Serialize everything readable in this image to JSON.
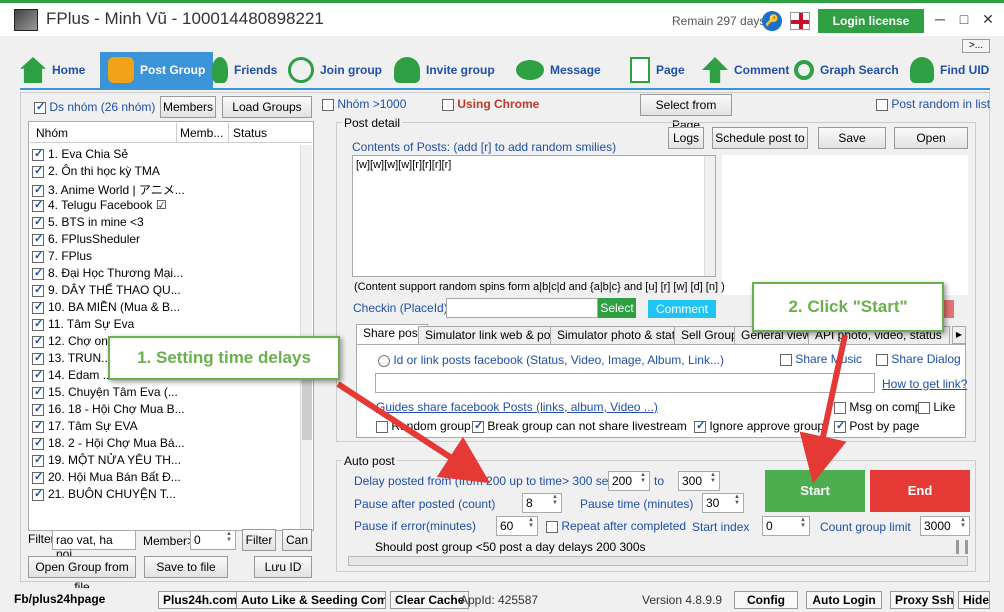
{
  "window": {
    "title": "FPlus - Minh Vũ - 100014480898221",
    "remain": "Remain 297 days",
    "login_license": "Login license",
    "minimize": "─",
    "maximize": "□",
    "close": "✕",
    "more": ">..."
  },
  "toolbar": {
    "home": "Home",
    "post_group": "Post Group",
    "friends": "Friends",
    "join_group": "Join group",
    "invite_group": "Invite group",
    "message": "Message",
    "page": "Page",
    "comment": "Comment",
    "graph_search": "Graph Search",
    "find_uid": "Find UID"
  },
  "left": {
    "ds_nhom": "Ds nhóm (26 nhóm)",
    "members_btn": "Members",
    "load_groups_btn": "Load Groups",
    "columns": [
      "Nhóm",
      "Memb...",
      "Status"
    ],
    "groups": [
      "1. Eva Chia Sẻ",
      "2. Ôn thi học kỳ TMA",
      "3. Anime World | アニメ...",
      "4. Telugu Facebook ☑",
      "5. BTS in mine <3",
      "6. FPlusSheduler",
      "7. FPlus",
      "8. Đại Học Thương Mại...",
      "9. DÂY THỂ THAO QU...",
      "10. BA MIỀN (Mua & B...",
      "11. Tâm Sự Eva",
      "12. Chợ on...",
      "13. TRUN...",
      "14. Edam ...",
      "15. Chuyện Tâm Eva (...",
      "16. 18 - Hội Chợ Mua B...",
      "17. Tâm Sự EVA",
      "18. 2 - Hội Chợ Mua Bá...",
      "19. MỘT NỬA YÊU TH...",
      "20. Hội Mua Bán Bất Đ...",
      "21. BUÔN CHUYỆN T..."
    ],
    "filter_label": "Filter",
    "filter_value": "rao vat, ha noi",
    "member_label": "Member>",
    "member_value": "0",
    "filter_btn": "Filter",
    "can_btn": "Can",
    "open_group_btn": "Open Group from file",
    "save_file_btn": "Save to file",
    "luu_id_btn": "Lưu ID"
  },
  "top_options": {
    "nhom_1000": "Nhóm >1000",
    "using_chrome": "Using Chrome",
    "select_from_page": "Select from Page",
    "post_random": "Post random in list"
  },
  "post_detail": {
    "legend": "Post detail",
    "contents_label": "Contents of Posts: (add [r] to add random smilies)",
    "logs_btn": "Logs",
    "schedule_btn": "Schedule post to",
    "save_btn": "Save",
    "open_btn": "Open",
    "content_text": "[w][w][w][w][r][r][r][r]",
    "support_text": "(Content support random spins form a|b|c|d and {a|b|c} and [u] [r] [w] [d] [n] )",
    "checkin_label": "Checkin (PlaceId):",
    "select_btn": "Select",
    "comment_up_btn": "Comment up",
    "tabs": [
      "Share post",
      "Simulator link web & post",
      "Simulator photo & status",
      "Sell Group",
      "General view",
      "API photo, video, status"
    ],
    "id_link_label": "Id or link posts facebook (Status, Video, Image, Album, Link...)",
    "share_music": "Share Music",
    "share_dialog": "Share Dialog",
    "how_to_link": "How to get link?",
    "guides_link": "Guides share facebook Posts (links, album, Video ...)",
    "msg_on_comp": "Msg on comp",
    "like": "Like",
    "random_group": "Random group",
    "break_group": "Break group can not share livestream",
    "ignore_approve": "Ignore approve group",
    "post_by_page": "Post by page"
  },
  "auto_post": {
    "legend": "Auto post",
    "delay_label": "Delay posted from (from 200 up to time> 300 seconds)",
    "delay_from": "200",
    "to_label": "to",
    "delay_to": "300",
    "pause_after_label": "Pause after posted (count)",
    "pause_after_value": "8",
    "pause_time_label": "Pause time (minutes)",
    "pause_time_value": "30",
    "pause_error_label": "Pause if error(minutes)",
    "pause_error_value": "60",
    "repeat_label": "Repeat after completed",
    "start_index_label": "Start index",
    "start_index_value": "0",
    "count_limit_label": "Count group limit",
    "count_limit_value": "3000",
    "should_text": "Should post group <50 post a day delays 200 300s",
    "start_btn": "Start",
    "end_btn": "End"
  },
  "callouts": {
    "step1": "1. Setting time delays",
    "step2": "2. Click \"Start\""
  },
  "statusbar": {
    "fb": "Fb/plus24hpage",
    "plus24h": "Plus24h.com",
    "auto_like": "Auto Like & Seeding Com...",
    "clear_cache": "Clear Cache",
    "appid": "AppId: 425587",
    "version": "Version 4.8.9.9",
    "config": "Config",
    "auto_login": "Auto Login",
    "proxy": "Proxy Ssh",
    "hide": "Hide"
  },
  "colors": {
    "accent_green": "#2ea043",
    "active_tab": "#3b93d8",
    "start": "#4cae4f",
    "end": "#e53935",
    "link_blue": "#1f4fa8"
  }
}
